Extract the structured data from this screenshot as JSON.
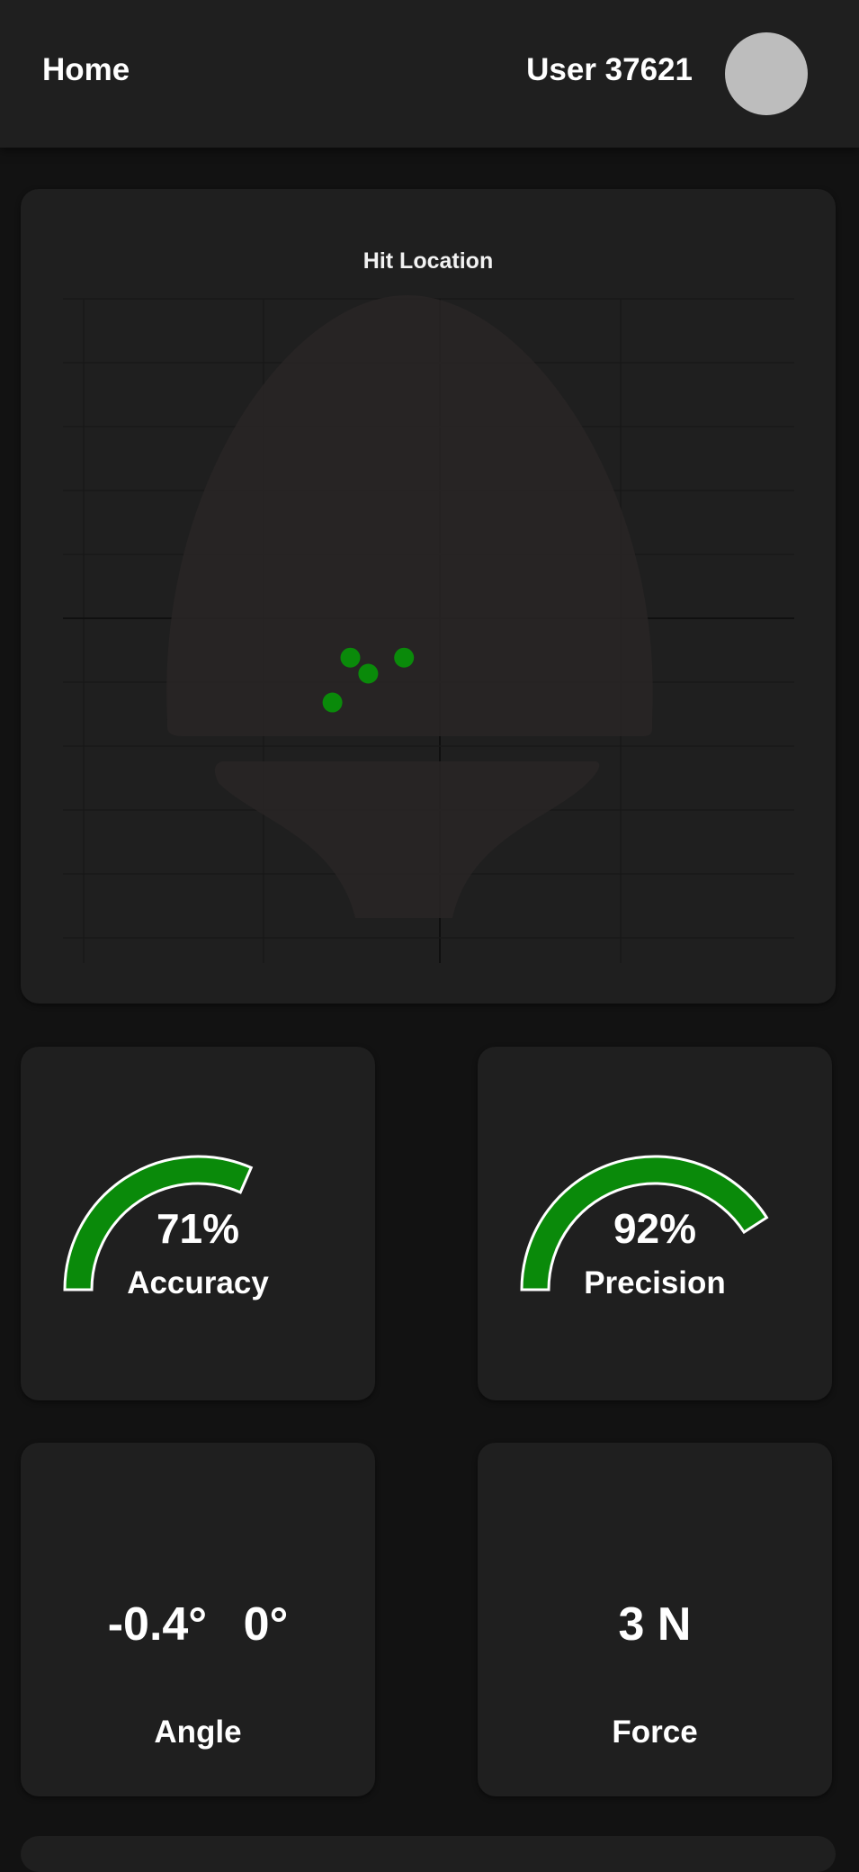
{
  "header": {
    "home_label": "Home",
    "user_label": "User 37621"
  },
  "hit_location": {
    "title": "Hit Location",
    "hits": [
      {
        "x": -0.25,
        "y": -0.12
      },
      {
        "x": -0.2,
        "y": -0.17
      },
      {
        "x": -0.1,
        "y": -0.12
      },
      {
        "x": -0.3,
        "y": -0.26
      }
    ],
    "point_color": "#0a8a0a"
  },
  "metrics": {
    "accuracy": {
      "value": 71,
      "display": "71%",
      "label": "Accuracy"
    },
    "precision": {
      "value": 92,
      "display": "92%",
      "label": "Precision"
    },
    "angle": {
      "x_display": "-0.4°",
      "y_display": "0°",
      "label": "Angle"
    },
    "force": {
      "display": "3 N",
      "label": "Force"
    }
  },
  "colors": {
    "background": "#121212",
    "card": "#1f1f1f",
    "gauge_fill": "#0a8a0a",
    "gauge_outline": "#ffffff"
  }
}
